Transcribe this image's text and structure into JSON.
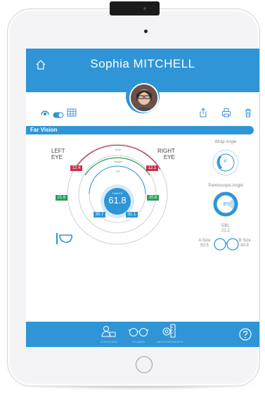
{
  "header": {
    "patient_name": "Sophia MITCHELL"
  },
  "section": {
    "title": "Far Vision"
  },
  "eyes": {
    "left_label_line1": "LEFT",
    "left_label_line2": "EYE",
    "right_label_line1": "RIGHT",
    "right_label_line2": "EYE"
  },
  "measurements": {
    "total_pd": "61.8",
    "total_pd_label": "Total PD",
    "left_height": "12.4",
    "right_height": "12.1",
    "left_pd": "21.6",
    "right_pd": "20.8",
    "left_vertex": "30.7",
    "right_vertex": "31.1",
    "ring_labels": [
      "Bxlb",
      "Height",
      "PD"
    ]
  },
  "angles": {
    "wrap_label": "Wrap Angle",
    "wrap_value": "4°",
    "pantoscopic_label": "Pantoscopic Angle",
    "pantoscopic_value": "8°"
  },
  "frame": {
    "dbl_label": "DBL",
    "dbl_value": "21.2",
    "a_size_label": "A Size",
    "a_size_value": "50.5",
    "b_size_label": "B Size",
    "b_size_value": "40.8"
  },
  "footer": {
    "tabs": [
      "OVERVIEW",
      "FRAMES",
      "MEASUREMENTS"
    ]
  },
  "colors": {
    "accent": "#2f95d6",
    "red": "#c8304a",
    "green": "#2a9d5c",
    "blue": "#2f95d6"
  }
}
